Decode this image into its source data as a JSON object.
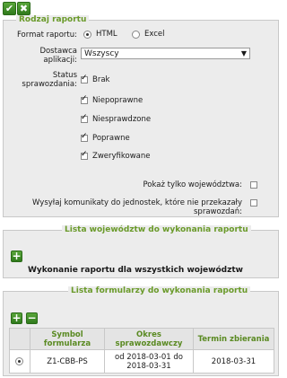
{
  "toolbar": {
    "confirm_icon": "✔",
    "cancel_icon": "✖"
  },
  "report_type": {
    "legend": "Rodzaj raportu",
    "format_label": "Format raportu:",
    "format_options": [
      "HTML",
      "Excel"
    ],
    "format_selected": "HTML",
    "supplier_label_1": "Dostawca",
    "supplier_label_2": "aplikacji:",
    "supplier_value": "Wszyscy",
    "status_label_1": "Status",
    "status_label_2": "sprawozdania:",
    "statuses": [
      {
        "label": "Brak",
        "checked": true
      },
      {
        "label": "Niepoprawne",
        "checked": true
      },
      {
        "label": "Niesprawdzone",
        "checked": true
      },
      {
        "label": "Poprawne",
        "checked": true
      },
      {
        "label": "Zweryfikowane",
        "checked": true
      }
    ],
    "only_voivodeship_label": "Pokaż tylko województwa:",
    "only_voivodeship_checked": false,
    "send_messages_label": "Wysyłaj komunikaty do jednostek, które nie przekazały sprawozdań:",
    "send_messages_checked": false
  },
  "voivodeships": {
    "legend": "Lista województw do wykonania raportu",
    "all_label": "Wykonanie raportu dla wszystkich województw"
  },
  "forms": {
    "legend": "Lista formularzy do wykonania raportu",
    "columns": [
      "Symbol formularza",
      "Okres sprawozdawczy",
      "Termin zbierania"
    ],
    "rows": [
      {
        "symbol": "Z1-CBB-PS",
        "period": "od 2018-03-01 do 2018-03-31",
        "deadline": "2018-03-31",
        "selected": true
      }
    ]
  }
}
